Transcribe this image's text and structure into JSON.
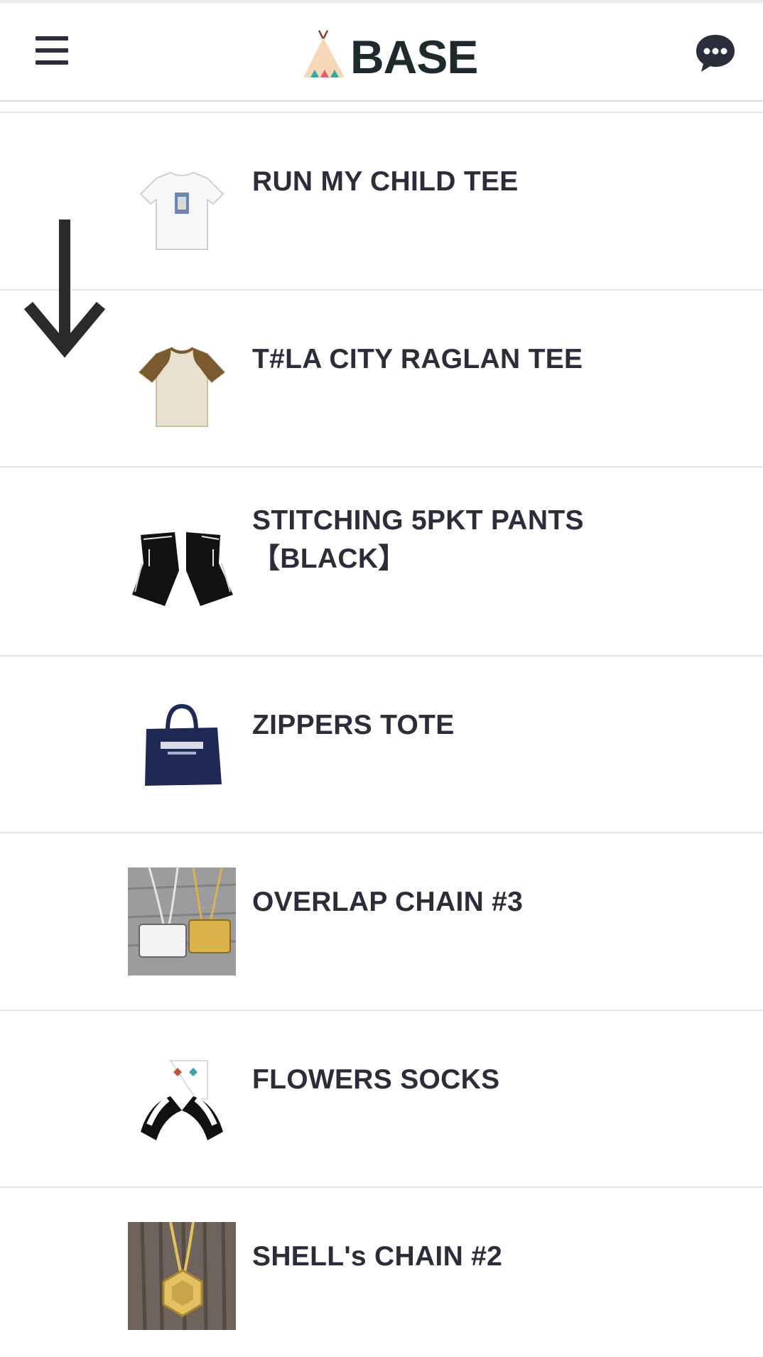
{
  "header": {
    "brand": "BASE",
    "menu_icon": "hamburger-menu-icon",
    "chat_icon": "chat-bubble-icon"
  },
  "products": [
    {
      "name": "RUN MY CHILD TEE",
      "image": "white-tshirt-thumbnail"
    },
    {
      "name": "T#LA CITY RAGLAN TEE",
      "image": "raglan-tshirt-thumbnail"
    },
    {
      "name": "STITCHING 5PKT PANTS【BLACK】",
      "image": "black-pants-thumbnail"
    },
    {
      "name": "ZIPPERS TOTE",
      "image": "navy-tote-bag-thumbnail"
    },
    {
      "name": "OVERLAP CHAIN #3",
      "image": "chain-necklaces-thumbnail"
    },
    {
      "name": "FLOWERS SOCKS",
      "image": "socks-thumbnail"
    },
    {
      "name": "SHELL's CHAIN #2",
      "image": "gold-pendant-thumbnail"
    }
  ],
  "overlay": {
    "icon": "down-arrow-icon"
  },
  "colors": {
    "text": "#2b2e3a",
    "divider": "#e6e6e8",
    "logo_text": "#1f2a2f"
  }
}
